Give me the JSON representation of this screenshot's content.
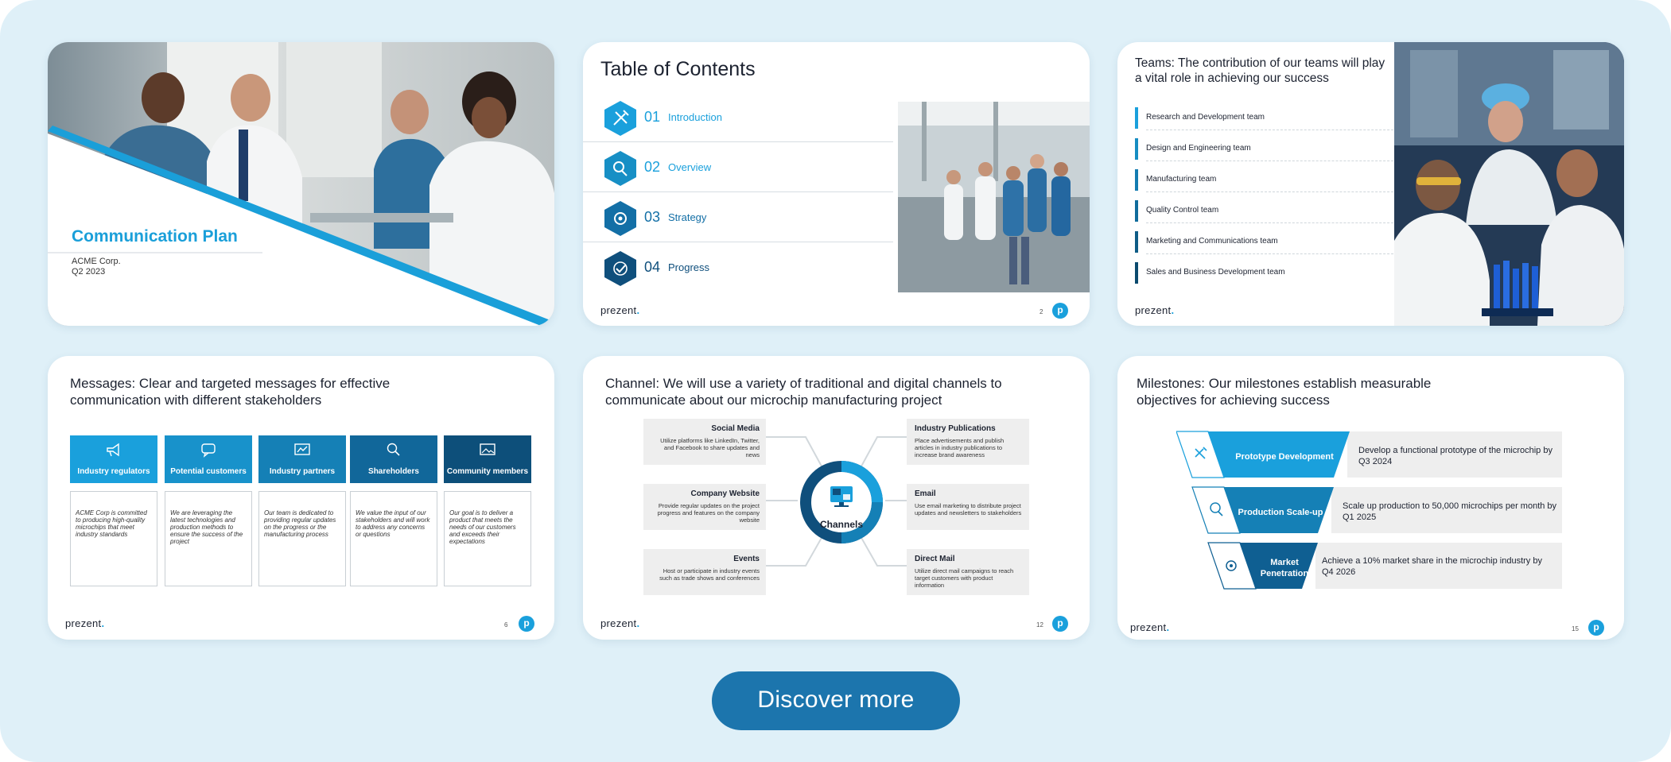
{
  "brand": {
    "logo_text": "prezent",
    "accent": "#1aa0dc",
    "dark": "#0f4f7c"
  },
  "slides": {
    "cover": {
      "title": "Communication Plan",
      "company": "ACME Corp.",
      "quarter": "Q2 2023"
    },
    "toc": {
      "title": "Table of Contents",
      "page": "2",
      "items": [
        {
          "num": "01",
          "label": "Introduction",
          "icon": "tools-icon"
        },
        {
          "num": "02",
          "label": "Overview",
          "icon": "magnifier-icon"
        },
        {
          "num": "03",
          "label": "Strategy",
          "icon": "gear-icon"
        },
        {
          "num": "04",
          "label": "Progress",
          "icon": "check-icon"
        }
      ]
    },
    "teams": {
      "title": "Teams: The contribution of our teams will play a vital role in achieving our success",
      "items": [
        "Research and Development team",
        "Design and Engineering team",
        "Manufacturing team",
        "Quality Control team",
        "Marketing and Communications team",
        "Sales and Business Development team"
      ]
    },
    "messages": {
      "title": "Messages: Clear and targeted messages for effective communication with different stakeholders",
      "page": "6",
      "columns": [
        {
          "label": "Industry regulators",
          "icon": "megaphone-icon",
          "text": "ACME Corp is committed to producing high-quality microchips that meet industry standards"
        },
        {
          "label": "Potential customers",
          "icon": "chat-icon",
          "text": "We are leveraging the latest technologies and production methods to ensure the success of the project"
        },
        {
          "label": "Industry partners",
          "icon": "chart-icon",
          "text": "Our team is dedicated to providing regular updates on the progress or the manufacturing process"
        },
        {
          "label": "Shareholders",
          "icon": "search-icon",
          "text": "We value the input of our stakeholders and will work to address any concerns or questions"
        },
        {
          "label": "Community members",
          "icon": "image-icon",
          "text": "Our goal is to deliver a product that meets the needs of our customers and exceeds their expectations"
        }
      ]
    },
    "channels": {
      "title": "Channel: We will use a variety of traditional and digital channels to communicate about our microchip manufacturing project",
      "center": "Channels",
      "page": "12",
      "left": [
        {
          "name": "Social Media",
          "text": "Utilize platforms like LinkedIn, Twitter, and Facebook to share updates and news"
        },
        {
          "name": "Company Website",
          "text": "Provide regular updates on the project progress and features on the company website"
        },
        {
          "name": "Events",
          "text": "Host or participate in industry events such as trade shows and conferences"
        }
      ],
      "right": [
        {
          "name": "Industry Publications",
          "text": "Place advertisements and publish articles in industry publications to increase brand awareness"
        },
        {
          "name": "Email",
          "text": "Use email marketing to distribute project updates and newsletters to stakeholders"
        },
        {
          "name": "Direct Mail",
          "text": "Utilize direct mail campaigns to reach target customers with product information"
        }
      ]
    },
    "milestones": {
      "title": "Milestones: Our milestones establish measurable objectives for achieving success",
      "page": "15",
      "items": [
        {
          "label": "Prototype Development",
          "desc": "Develop a functional prototype of the microchip by Q3 2024",
          "icon": "tools-icon"
        },
        {
          "label": "Production Scale-up",
          "desc": "Scale up production to 50,000 microchips per month by Q1 2025",
          "icon": "magnifier-icon"
        },
        {
          "label": "Market Penetration",
          "desc": "Achieve a 10% market share in the microchip industry by Q4 2026",
          "icon": "gear-icon"
        }
      ]
    }
  },
  "cta": {
    "label": "Discover more"
  }
}
